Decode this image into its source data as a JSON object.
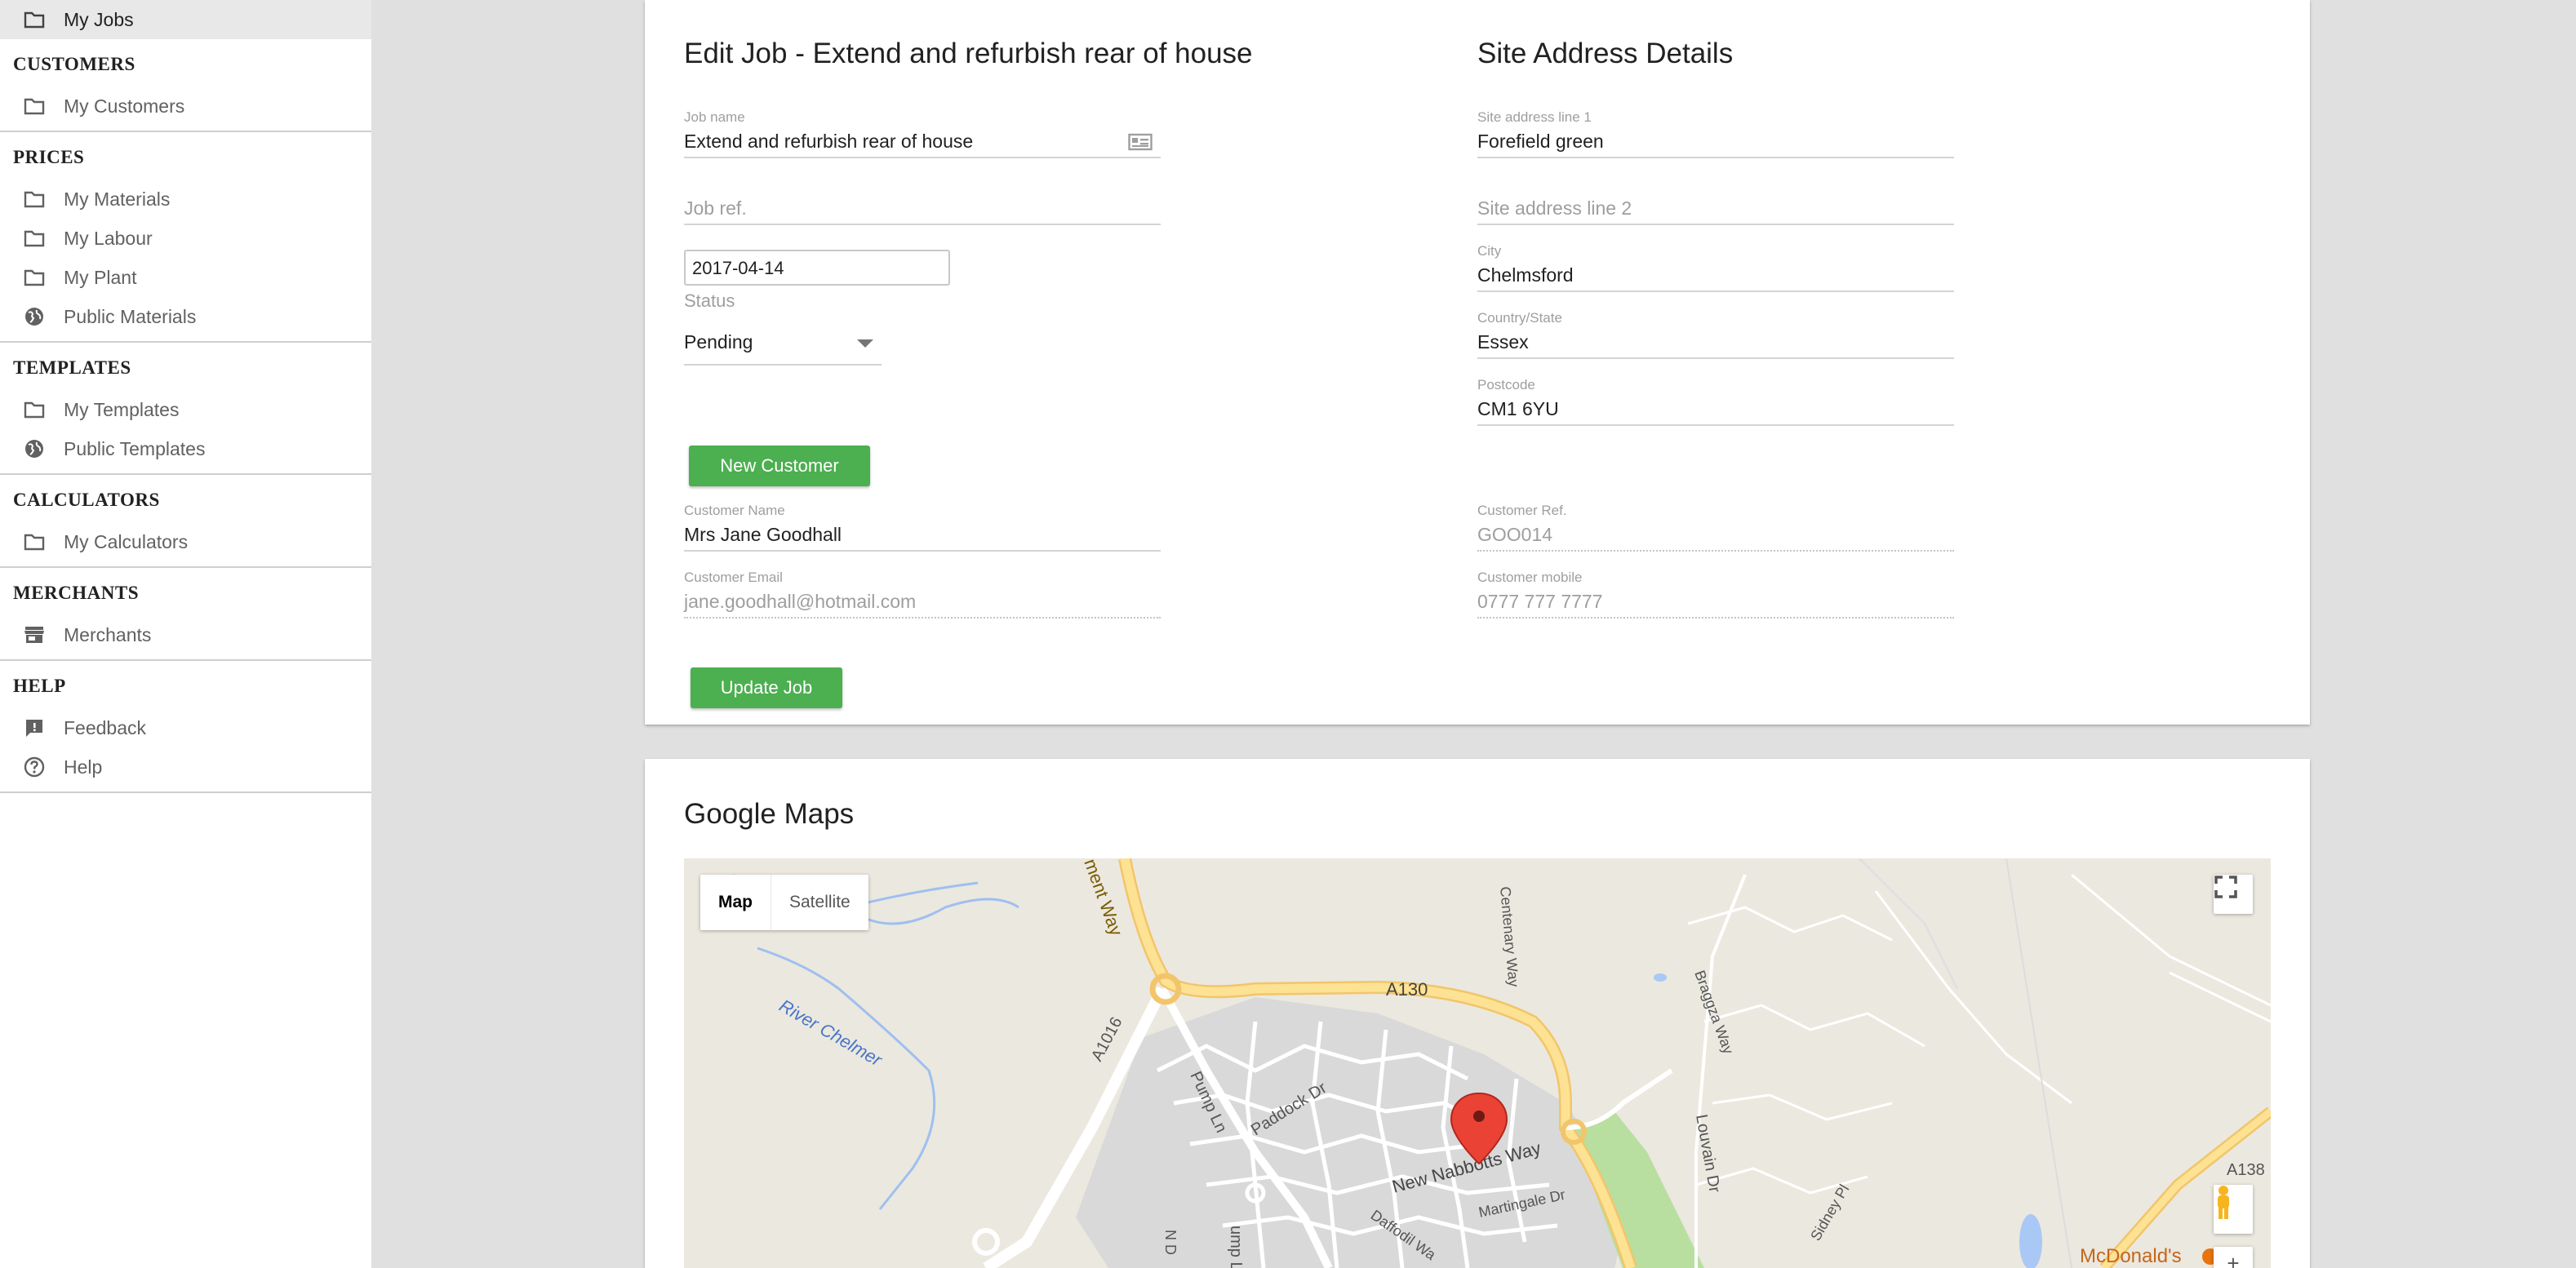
{
  "sidebar": {
    "top_item": {
      "label": "My Jobs",
      "icon": "folder-icon"
    },
    "sections": [
      {
        "title": "CUSTOMERS",
        "items": [
          {
            "label": "My Customers",
            "icon": "folder-icon"
          }
        ]
      },
      {
        "title": "PRICES",
        "items": [
          {
            "label": "My Materials",
            "icon": "folder-icon"
          },
          {
            "label": "My Labour",
            "icon": "folder-icon"
          },
          {
            "label": "My Plant",
            "icon": "folder-icon"
          },
          {
            "label": "Public Materials",
            "icon": "globe-icon"
          }
        ]
      },
      {
        "title": "TEMPLATES",
        "items": [
          {
            "label": "My Templates",
            "icon": "folder-icon"
          },
          {
            "label": "Public Templates",
            "icon": "globe-icon"
          }
        ]
      },
      {
        "title": "CALCULATORS",
        "items": [
          {
            "label": "My Calculators",
            "icon": "folder-icon"
          }
        ]
      },
      {
        "title": "MERCHANTS",
        "items": [
          {
            "label": "Merchants",
            "icon": "store-icon"
          }
        ]
      },
      {
        "title": "HELP",
        "items": [
          {
            "label": "Feedback",
            "icon": "feedback-icon"
          },
          {
            "label": "Help",
            "icon": "help-icon"
          }
        ]
      }
    ]
  },
  "job_form": {
    "title": "Edit Job - Extend and refurbish rear of house",
    "job_name_label": "Job name",
    "job_name_value": "Extend and refurbish rear of house",
    "job_ref_placeholder": "Job ref.",
    "date_value": "2017-04-14",
    "status_label": "Status",
    "status_value": "Pending",
    "new_customer_button": "New Customer",
    "customer_name_label": "Customer Name",
    "customer_name_value": "Mrs Jane Goodhall",
    "customer_email_label": "Customer Email",
    "customer_email_value": "jane.goodhall@hotmail.com",
    "update_job_button": "Update Job"
  },
  "site_address": {
    "title": "Site Address Details",
    "line1_label": "Site address line 1",
    "line1_value": "Forefield green",
    "line2_placeholder": "Site address line 2",
    "city_label": "City",
    "city_value": "Chelmsford",
    "country_label": "Country/State",
    "country_value": "Essex",
    "postcode_label": "Postcode",
    "postcode_value": "CM1 6YU",
    "customer_ref_label": "Customer Ref.",
    "customer_ref_value": "GOO014",
    "customer_mobile_label": "Customer mobile",
    "customer_mobile_value": "0777 777 7777"
  },
  "map_card": {
    "title": "Google Maps",
    "map_button": "Map",
    "satellite_button": "Satellite",
    "labels": {
      "road_a130": "A130",
      "road_a1016": "A1016",
      "road_a138": "A138",
      "centenary_way": "Centenary Way",
      "ment_way": "ment Way",
      "river": "River Chelmer",
      "pump_ln": "Pump Ln",
      "paddock_dr": "Paddock Dr",
      "new_nabbotts": "New Nabbotts Way",
      "martingale": "Martingale Dr",
      "daffodil": "Daffodil Wa",
      "bragg": "Braggza Way",
      "louvain": "Louvain Dr",
      "sidney": "Sidney Pl",
      "mcdonalds": "McDonald's",
      "n_d": "N D",
      "ump_ln": "ump Ln"
    }
  },
  "colors": {
    "accent_green": "#4caf50",
    "background": "#e0e0e0",
    "map_land": "#ebe8df",
    "map_major_road": "#fde293",
    "marker": "#ea4335"
  }
}
